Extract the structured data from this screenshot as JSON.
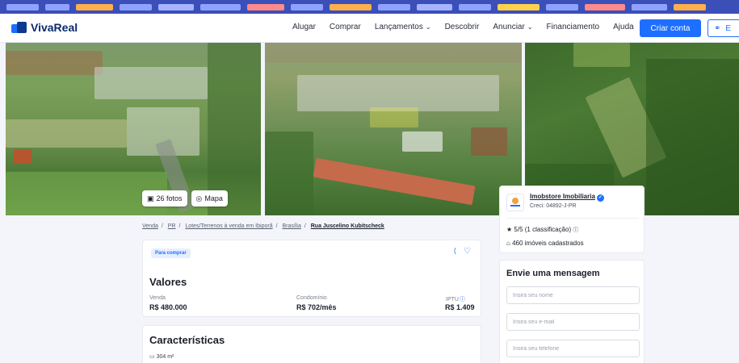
{
  "nav": {
    "logo": "VivaReal",
    "items": [
      {
        "label": "Alugar",
        "chevron": false
      },
      {
        "label": "Comprar",
        "chevron": false
      },
      {
        "label": "Lançamentos",
        "chevron": true
      },
      {
        "label": "Descobrir",
        "chevron": false
      },
      {
        "label": "Anunciar",
        "chevron": true
      },
      {
        "label": "Financiamento",
        "chevron": false
      },
      {
        "label": "Ajuda",
        "chevron": false
      }
    ],
    "cta_label": "Criar conta",
    "login_label": "E"
  },
  "gallery": {
    "photos_label": "26 fotos",
    "map_label": "Mapa"
  },
  "breadcrumb": {
    "items": [
      "Venda",
      "PR",
      "Lotes/Terrenos à venda em Ibiporã",
      "Brasília"
    ],
    "current": "Rua Juscelino Kubitscheck"
  },
  "listing": {
    "tag": "Para comprar",
    "valores_title": "Valores",
    "venda_label": "Venda",
    "venda_value": "R$ 480.000",
    "condominio_label": "Condomínio",
    "condominio_value": "R$ 702/mês",
    "iptu_label": "IPTU",
    "iptu_value": "R$ 1.409",
    "caracteristicas_title": "Características",
    "area": "304 m²"
  },
  "agent": {
    "name": "Imobstore Imobiliaria",
    "creci": "Creci: 04892-J-PR",
    "rating": "5/5 (1 classificação)",
    "listings": "460 imóveis cadastrados"
  },
  "message_form": {
    "title": "Envie uma mensagem",
    "name_placeholder": "Insira seu nome",
    "email_placeholder": "Insira seu e-mail",
    "phone_placeholder": "Insira seu telefone"
  },
  "colors": {
    "brand": "#1e6fff",
    "brand_dark": "#0b2a6b",
    "background": "#f3f5fa"
  }
}
